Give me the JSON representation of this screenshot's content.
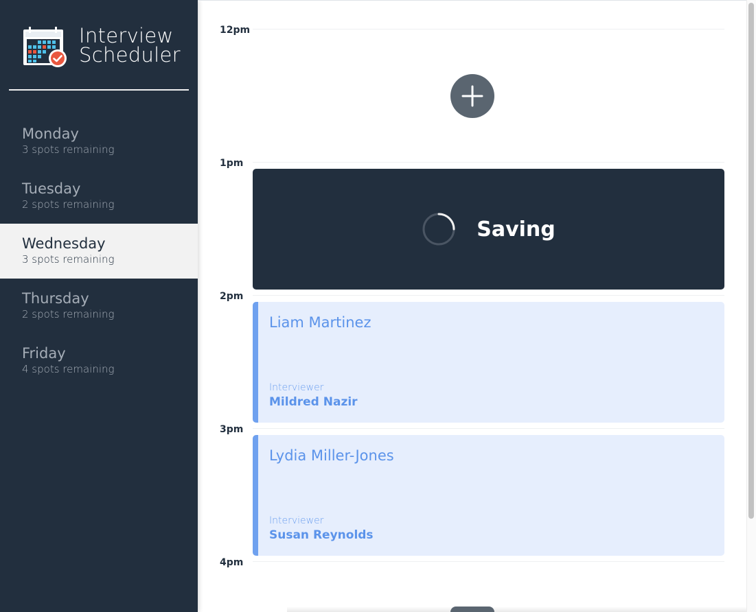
{
  "brand": {
    "title_line1": "Interview",
    "title_line2": "Scheduler"
  },
  "days": [
    {
      "name": "Monday",
      "spots": "3 spots remaining"
    },
    {
      "name": "Tuesday",
      "spots": "2 spots remaining"
    },
    {
      "name": "Wednesday",
      "spots": "3 spots remaining",
      "selected": true
    },
    {
      "name": "Thursday",
      "spots": "2 spots remaining"
    },
    {
      "name": "Friday",
      "spots": "4 spots remaining"
    }
  ],
  "schedule": {
    "times": [
      "12pm",
      "1pm",
      "2pm",
      "3pm",
      "4pm"
    ],
    "saving_label": "Saving",
    "appointments": [
      {
        "student": "Liam Martinez",
        "interviewer_label": "Interviewer",
        "interviewer": "Mildred Nazir"
      },
      {
        "student": "Lydia Miller-Jones",
        "interviewer_label": "Interviewer",
        "interviewer": "Susan Reynolds"
      }
    ]
  },
  "colors": {
    "sidebar_bg": "#222f3e",
    "selected_day_bg": "#f2f2f2",
    "appointment_bg": "#e6eefd",
    "appointment_accent": "#6fa1ef",
    "add_button": "#5a6570"
  },
  "icons": [
    "calendar-logo-icon",
    "add-icon",
    "loading-spinner-icon"
  ]
}
